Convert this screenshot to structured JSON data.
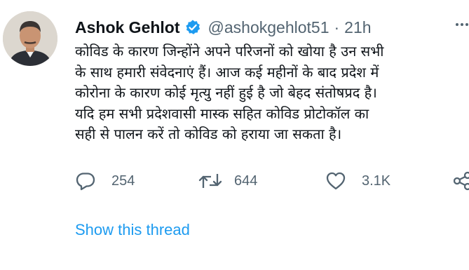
{
  "tweet": {
    "author": {
      "display_name": "Ashok Gehlot",
      "handle": "@ashokgehlot51",
      "verified_icon": "verified-badge-icon",
      "avatar_icon": "profile-photo"
    },
    "separator": "·",
    "time": "21h",
    "more_icon": "more-icon",
    "lines": [
      "कोविड के कारण जिन्होंने अपने परिजनों को खोया है उन सभी",
      "के साथ हमारी संवेदनाएं हैं। आज कई महीनों के बाद प्रदेश में",
      "कोरोना के कारण कोई मृत्यु नहीं हुई है जो बेहद संतोषप्रद है।",
      "यदि हम सभी प्रदेशवासी मास्क सहित कोविड प्रोटोकॉल का",
      "सही से पालन करें तो कोविड को हराया जा सकता है।"
    ],
    "actions": {
      "reply": {
        "icon": "reply-icon",
        "count": "254"
      },
      "retweet": {
        "icon": "retweet-icon",
        "count": "644"
      },
      "like": {
        "icon": "like-icon",
        "count": "3.1K"
      },
      "share": {
        "icon": "share-icon"
      }
    },
    "show_thread": "Show this thread",
    "colors": {
      "text": "#0f1419",
      "secondary": "#536471",
      "link": "#1d9bf0",
      "verified": "#1d9bf0"
    }
  }
}
